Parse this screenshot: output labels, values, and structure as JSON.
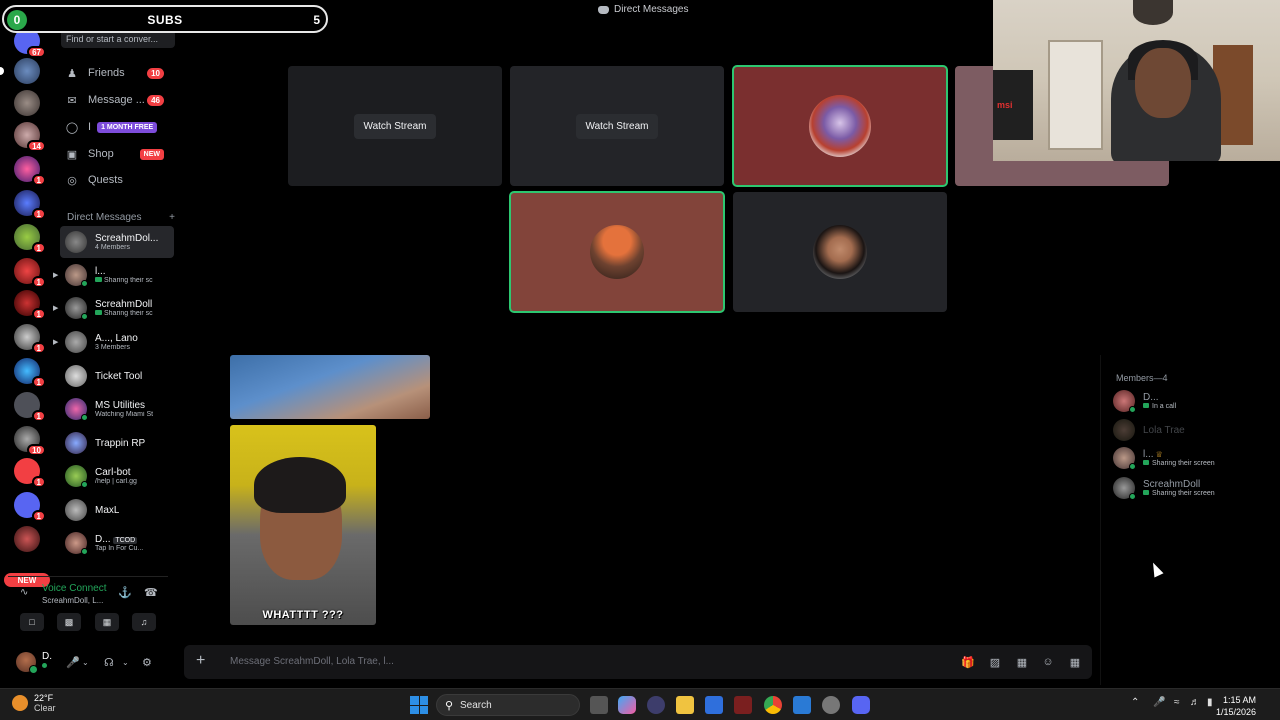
{
  "overlay": {
    "subs_left": "0",
    "subs_label": "SUBS",
    "subs_right": "5"
  },
  "titlebar": {
    "title": "Direct Messages"
  },
  "rail": {
    "badges": [
      "67",
      "1",
      "14",
      "1",
      "1",
      "1",
      "1",
      "1",
      "1",
      "1",
      "1",
      "1",
      "10",
      "1",
      "1"
    ],
    "new_label": "NEW"
  },
  "sidebar": {
    "search_placeholder": "Find or start a conver...",
    "nav": [
      {
        "label": "Friends",
        "count": "10"
      },
      {
        "label": "Message ...",
        "count": "46"
      },
      {
        "label": "I",
        "tag": "1 MONTH FREE"
      },
      {
        "label": "Shop",
        "tag": "NEW"
      },
      {
        "label": "Quests"
      }
    ],
    "dm_header": "Direct Messages",
    "dm_add": "+",
    "dms": [
      {
        "name": "ScreahmDol...",
        "sub": "4 Members"
      },
      {
        "name": "l...",
        "sub": "Sharing their sc"
      },
      {
        "name": "ScreahmDoll",
        "sub": "Sharing their sc"
      },
      {
        "name": "A..., Lano",
        "sub": "3 Members"
      },
      {
        "name": "Ticket Tool",
        "sub": ""
      },
      {
        "name": "MS Utilities",
        "sub": "Watching Miami St"
      },
      {
        "name": "Trappin RP",
        "sub": ""
      },
      {
        "name": "Carl-bot",
        "sub": "/help | carl.gg"
      },
      {
        "name": "MaxL",
        "sub": ""
      },
      {
        "name": "D...",
        "tag": "TCOD",
        "sub": "Tap In For Cu..."
      }
    ]
  },
  "voice": {
    "status": "Voice Connect",
    "channel": "ScreahmDoll, L..."
  },
  "user": {
    "name": "D."
  },
  "call": {
    "watch_label": "Watch Stream"
  },
  "chat": {
    "caption": "WHATTTT ???",
    "placeholder": "Message ScreahmDoll, Lola Trae, l..."
  },
  "members": {
    "header": "Members—4",
    "list": [
      {
        "name": "D...",
        "sub": "In a call"
      },
      {
        "name": "Lola Trae",
        "sub": ""
      },
      {
        "name": "l...",
        "sub": "Sharing their screen"
      },
      {
        "name": "ScreahmDoll",
        "sub": "Sharing their screen"
      }
    ]
  },
  "webcam": {
    "brand": "msi"
  },
  "taskbar": {
    "temp": "22°F",
    "cond": "Clear",
    "search": "Search",
    "time": "1:15 AM",
    "date": "1/15/2026"
  }
}
